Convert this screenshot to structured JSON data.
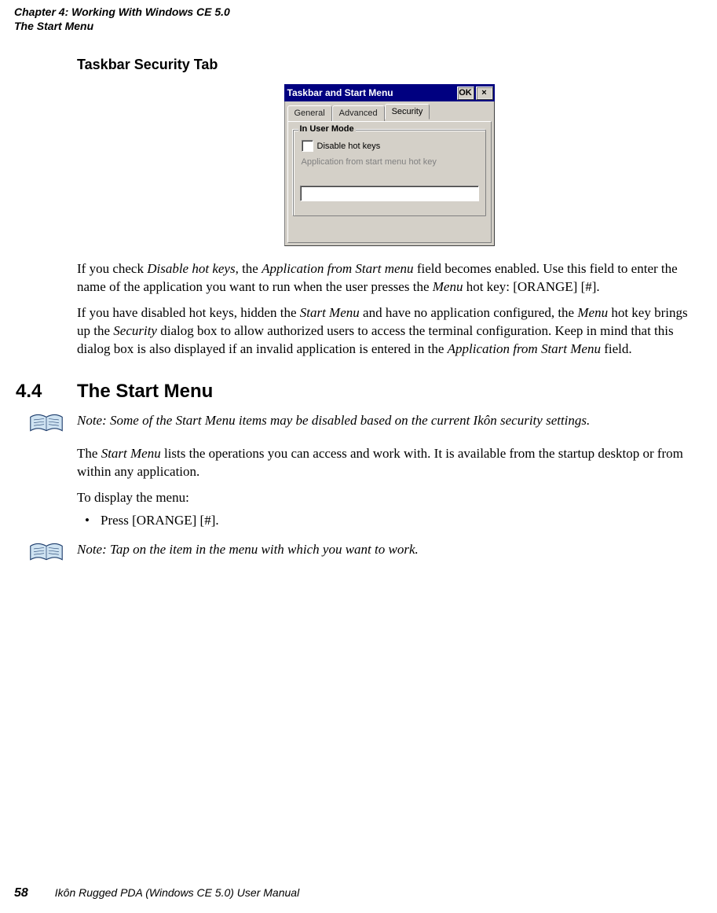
{
  "header": {
    "line1": "Chapter 4:  Working With Windows CE 5.0",
    "line2": "The Start Menu"
  },
  "h3": "Taskbar Security Tab",
  "dialog": {
    "title": "Taskbar and Start Menu",
    "ok": "OK",
    "close": "×",
    "tabs": {
      "general": "General",
      "advanced": "Advanced",
      "security": "Security"
    },
    "group_legend": "In User Mode",
    "chk_label": "Disable hot keys",
    "app_label": "Application from start menu hot key",
    "text_value": ""
  },
  "p1_a": "If you check ",
  "p1_b": "Disable hot keys",
  "p1_c": ", the ",
  "p1_d": "Application from Start menu",
  "p1_e": " field becomes enabled. Use this field to enter the name of the application you want to run when the user presses the ",
  "p1_f": "Menu",
  "p1_g": " hot key: [ORANGE] [#].",
  "p2_a": "If you have disabled hot keys, hidden the ",
  "p2_b": "Start Menu",
  "p2_c": " and have no application configured, the ",
  "p2_d": "Menu",
  "p2_e": " hot key brings up the ",
  "p2_f": "Security",
  "p2_g": " dialog box to allow authorized users to access the terminal configuration. Keep in mind that this dialog box is also displayed if an invalid application is entered in the ",
  "p2_h": "Application from Start Menu",
  "p2_i": " field.",
  "section": {
    "num": "4.4",
    "title": "The Start Menu"
  },
  "note1": "Note: Some of the Start Menu items may be disabled based on the current Ikôn security settings.",
  "p3_a": "The ",
  "p3_b": "Start Menu",
  "p3_c": " lists the operations you can access and work with. It is available from the startup desktop or from within any application.",
  "p4": "To display the menu:",
  "bullet1": "Press [ORANGE] [#].",
  "note2": "Note: Tap on the item in the menu with which you want to work.",
  "footer": {
    "page": "58",
    "doc": "Ikôn Rugged PDA (Windows CE 5.0) User Manual"
  }
}
